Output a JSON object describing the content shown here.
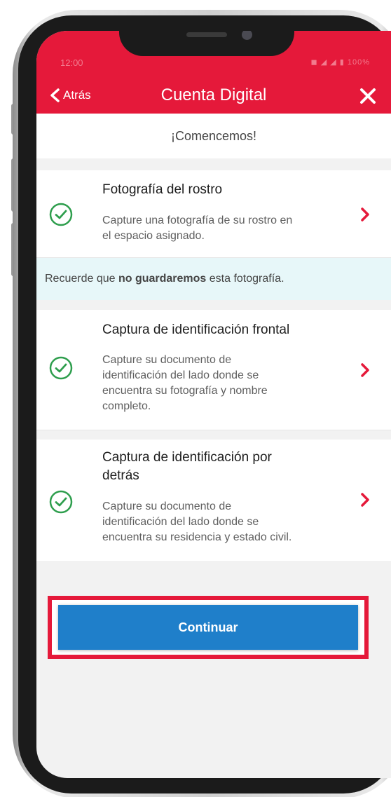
{
  "status_bar": {
    "time": "12:00",
    "icons": "◼ ◢ ◢ ▮ 100%"
  },
  "header": {
    "back_label": "Atrás",
    "title": "Cuenta Digital"
  },
  "subheader": "¡Comencemos!",
  "steps": [
    {
      "title": "Fotografía del rostro",
      "description": [
        "Capture una fotografía de su rostro en",
        "el espacio asignado."
      ],
      "status": "completed"
    },
    {
      "title": "Captura de identificación frontal",
      "description": [
        "Capture su documento de",
        "identificación del lado donde se",
        "encuentra su fotografía y nombre",
        "completo."
      ],
      "status": "completed"
    },
    {
      "title_lines": [
        "Captura de identificación por",
        "detrás"
      ],
      "description": [
        "Capture su documento de",
        "identificación del lado donde se",
        "encuentra su residencia y estado civil."
      ],
      "status": "completed"
    }
  ],
  "notice": {
    "before": "Recuerde que ",
    "bold": "no guardaremos",
    "after": " esta fotografía."
  },
  "continue_button": "Continuar",
  "colors": {
    "brand_red": "#e5193a",
    "check_green": "#2e9e4d",
    "button_blue": "#1f7fca",
    "notice_bg": "#e7f7f9"
  },
  "icons": {
    "back": "chevron-left-icon",
    "close": "close-icon",
    "step_status": "check-circle-icon",
    "step_nav": "chevron-right-icon"
  }
}
